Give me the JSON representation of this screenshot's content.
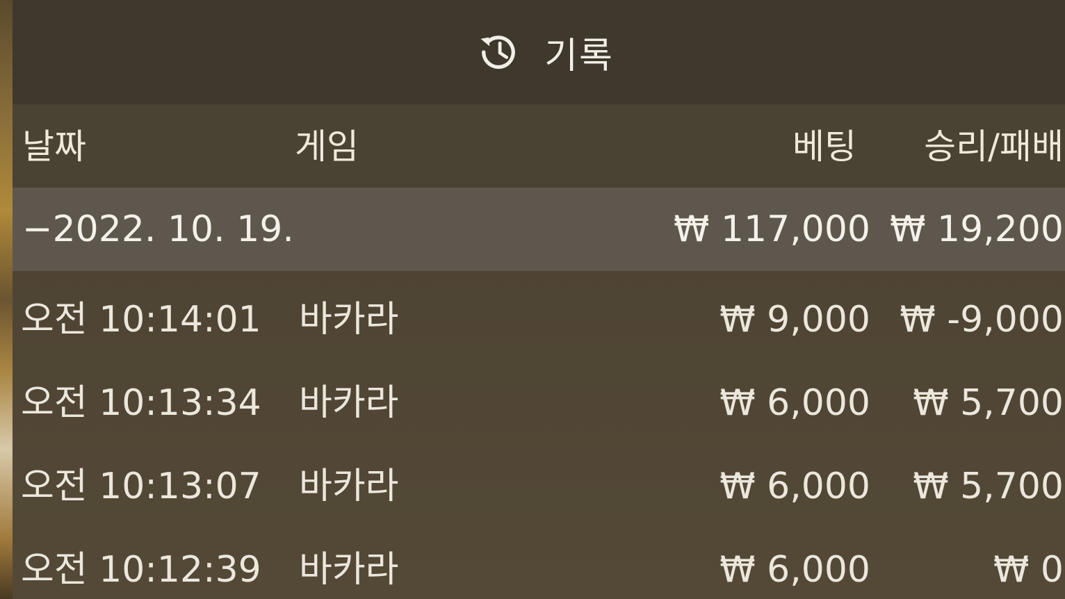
{
  "title": {
    "icon": "history-icon",
    "label": "기록"
  },
  "columns": {
    "date": "날짜",
    "game": "게임",
    "bet": "베팅",
    "win_loss": "승리/패배"
  },
  "summary": {
    "date": "−2022. 10. 19.",
    "bet": "₩ 117,000",
    "win_loss": "₩ 19,200"
  },
  "rows": [
    {
      "time": "오전 10:14:01",
      "game": "바카라",
      "bet": "₩ 9,000",
      "win_loss": "₩ -9,000"
    },
    {
      "time": "오전 10:13:34",
      "game": "바카라",
      "bet": "₩ 6,000",
      "win_loss": "₩ 5,700"
    },
    {
      "time": "오전 10:13:07",
      "game": "바카라",
      "bet": "₩ 6,000",
      "win_loss": "₩ 5,700"
    },
    {
      "time": "오전 10:12:39",
      "game": "바카라",
      "bet": "₩ 6,000",
      "win_loss": "₩ 0"
    }
  ],
  "colors": {
    "panel_bg": "#4e4433",
    "title_bg": "#3f382d",
    "summary_bg": "#5e574d",
    "text": "#efe9dc"
  }
}
